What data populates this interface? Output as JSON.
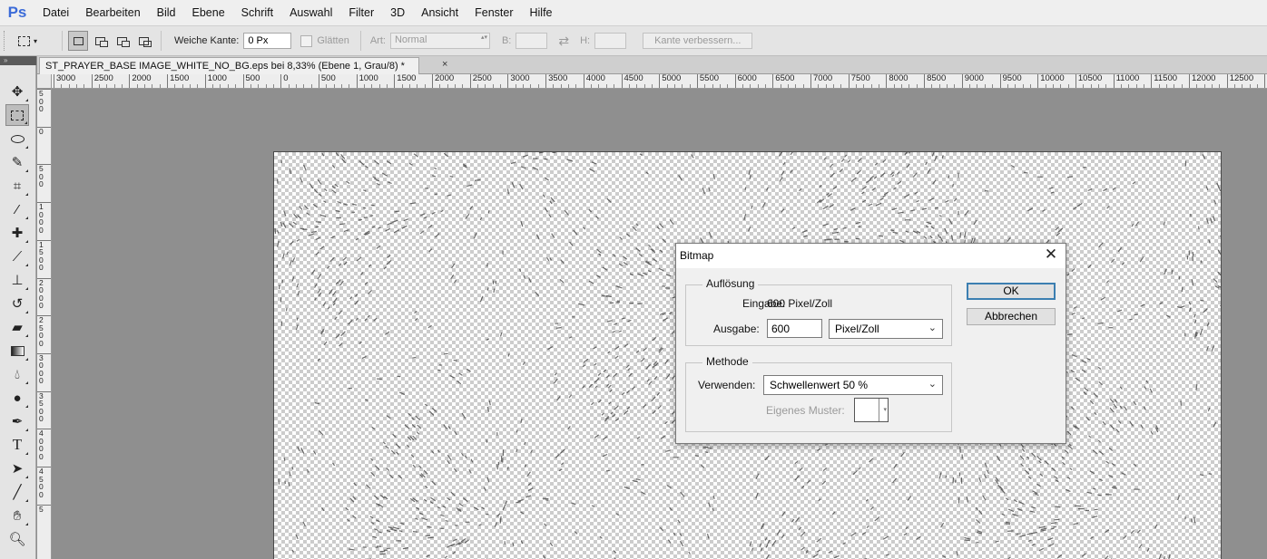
{
  "app": {
    "logo": "Ps"
  },
  "menu": [
    "Datei",
    "Bearbeiten",
    "Bild",
    "Ebene",
    "Schrift",
    "Auswahl",
    "Filter",
    "3D",
    "Ansicht",
    "Fenster",
    "Hilfe"
  ],
  "options": {
    "feather_label": "Weiche Kante:",
    "feather_value": "0 Px",
    "antialias_label": "Glätten",
    "style_label": "Art:",
    "style_value": "Normal",
    "width_label": "B:",
    "height_label": "H:",
    "refine_edge_label": "Kante verbessern..."
  },
  "document": {
    "tab_title": "ST_PRAYER_BASE IMAGE_WHITE_NO_BG.eps bei 8,33% (Ebene 1, Grau/8) *",
    "close_glyph": "×"
  },
  "ruler": {
    "h_labels": [
      "3000",
      "2500",
      "2000",
      "1500",
      "1000",
      "500",
      "0",
      "500",
      "1000",
      "1500",
      "2000",
      "2500",
      "3000",
      "3500",
      "4000",
      "4500",
      "5000",
      "5500",
      "6000",
      "6500",
      "7000",
      "7500",
      "8000",
      "8500",
      "9000",
      "9500",
      "10000",
      "10500",
      "11000",
      "11500",
      "12000",
      "12500",
      "13"
    ],
    "v_labels": [
      "500",
      "0",
      "500",
      "1000",
      "1500",
      "2000",
      "2500",
      "3000",
      "3500",
      "4000",
      "4500",
      "5"
    ]
  },
  "toolbar": {
    "tools": [
      "move-tool",
      "rect-marquee-tool",
      "lasso-tool",
      "quick-select-tool",
      "crop-tool",
      "eyedropper-tool",
      "healing-brush-tool",
      "brush-tool",
      "clone-stamp-tool",
      "history-brush-tool",
      "eraser-tool",
      "gradient-tool",
      "blur-tool",
      "dodge-tool",
      "pen-tool",
      "type-tool",
      "path-select-tool",
      "line-tool",
      "hand-tool",
      "zoom-tool"
    ],
    "active": "rect-marquee-tool"
  },
  "dialog": {
    "title": "Bitmap",
    "close_glyph": "✕",
    "resolution": {
      "group_title": "Auflösung",
      "input_label": "Eingabe:",
      "input_value": "600 Pixel/Zoll",
      "output_label": "Ausgabe:",
      "output_value": "600",
      "output_unit": "Pixel/Zoll"
    },
    "method": {
      "group_title": "Methode",
      "use_label": "Verwenden:",
      "use_value": "Schwellenwert 50 %",
      "pattern_label": "Eigenes Muster:"
    },
    "ok_label": "OK",
    "cancel_label": "Abbrechen"
  },
  "colors": {
    "workspace": "#8f8f8f",
    "dialog_default_border": "#3c7fb1",
    "logo": "#3b6bd8"
  }
}
